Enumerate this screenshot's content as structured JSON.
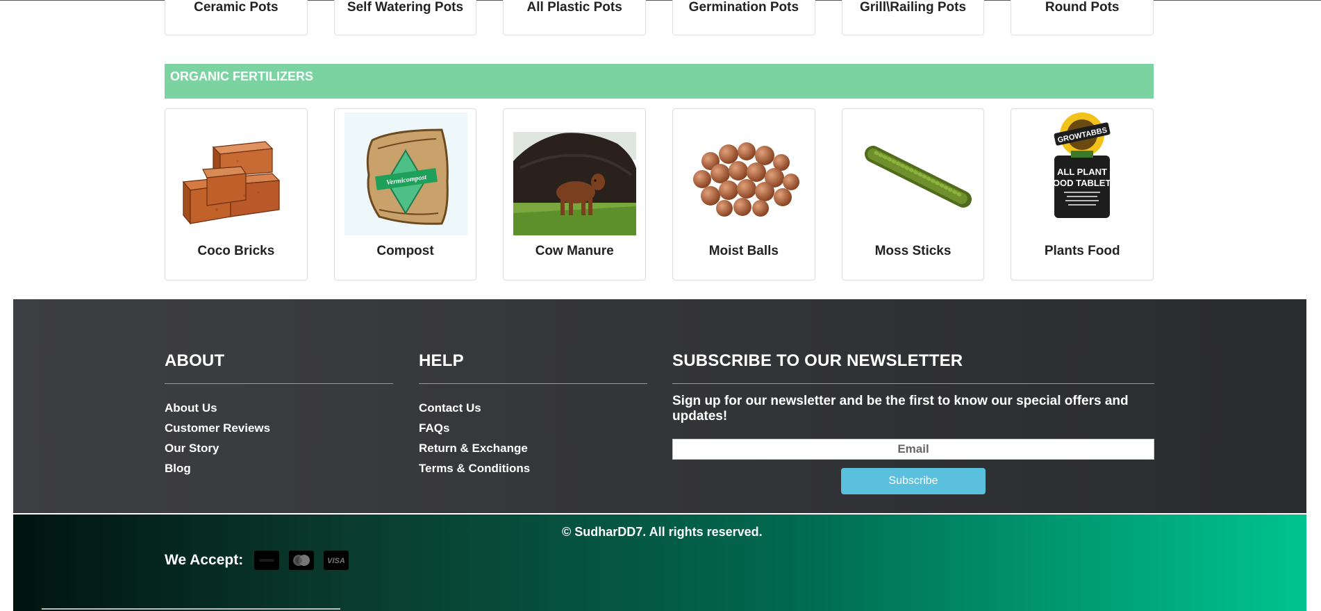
{
  "pots": [
    "Ceramic Pots",
    "Self Watering Pots",
    "All Plastic Pots",
    "Germination Pots",
    "Grill\\Railing Pots",
    "Round Pots"
  ],
  "section": {
    "title": "ORGANIC FERTILIZERS"
  },
  "fertilizers": [
    {
      "name": "Coco Bricks",
      "icon": "coco-bricks-image"
    },
    {
      "name": "Compost",
      "icon": "compost-bag-image",
      "bag_text": "Vermicompost"
    },
    {
      "name": "Cow Manure",
      "icon": "cow-manure-image"
    },
    {
      "name": "Moist Balls",
      "icon": "moist-balls-image"
    },
    {
      "name": "Moss Sticks",
      "icon": "moss-stick-image"
    },
    {
      "name": "Plants Food",
      "icon": "plants-food-image",
      "brand": "GROWTABBS",
      "pack_title_1": "ALL PLANT",
      "pack_title_2": "FOOD TABLETS"
    }
  ],
  "footer": {
    "about": {
      "title": "ABOUT",
      "links": [
        "About Us",
        "Customer Reviews",
        "Our Story",
        "Blog"
      ]
    },
    "help": {
      "title": "HELP",
      "links": [
        "Contact Us",
        "FAQs",
        "Return & Exchange",
        "Terms & Conditions"
      ]
    },
    "newsletter": {
      "title": "SUBSCRIBE TO OUR NEWSLETTER",
      "text": "Sign up for our newsletter and be the first to know our special offers and updates!",
      "placeholder": "Email",
      "button": "Subscribe"
    }
  },
  "bottom": {
    "copyright": "© SudharDD7. All rights reserved.",
    "accept_label": "We Accept:",
    "payment_icons": [
      "paypal-icon",
      "mastercard-icon",
      "visa-icon"
    ],
    "visa_text": "VISA"
  },
  "colors": {
    "section_green": "#7ad3a0",
    "subscribe_blue": "#5bc0de",
    "footer_dark": "#3e3f42",
    "bottom_green": "#00c390"
  }
}
